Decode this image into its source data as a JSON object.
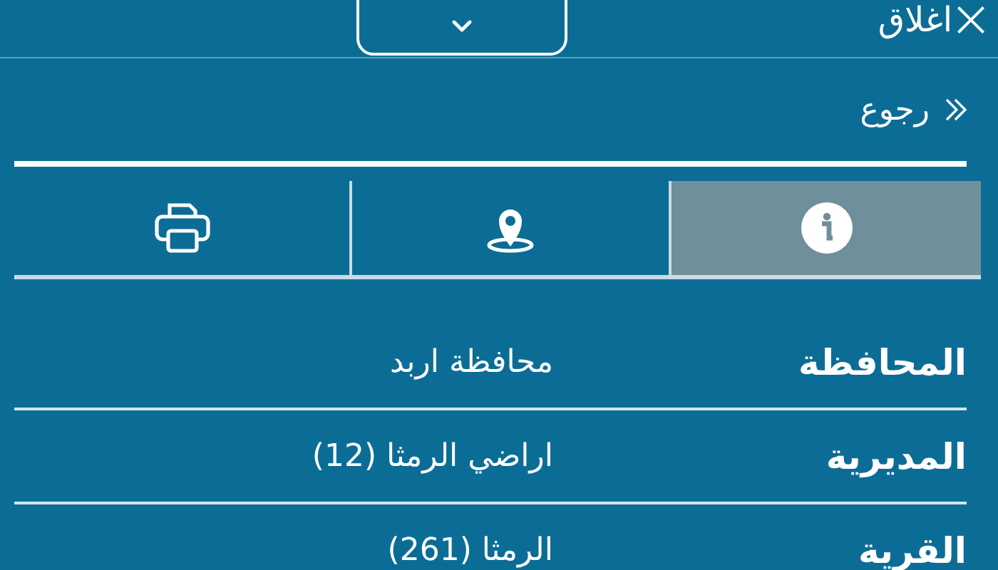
{
  "top_bar": {
    "close_label": "اغلاق"
  },
  "back": {
    "label": "رجوع"
  },
  "tabs": [
    {
      "kind": "info",
      "selected": true
    },
    {
      "kind": "location",
      "selected": false
    },
    {
      "kind": "print",
      "selected": false
    }
  ],
  "details": [
    {
      "label": "المحافظة",
      "value": "محافظة اربد"
    },
    {
      "label": "المديرية",
      "value": "اراضي الرمثا (12)"
    },
    {
      "label": "القرية",
      "value": "الرمثا (261)"
    }
  ]
}
